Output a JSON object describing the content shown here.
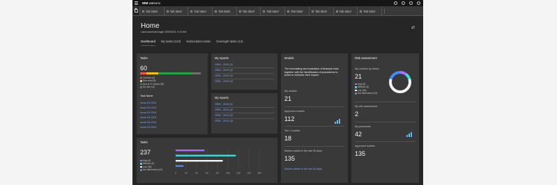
{
  "brand": {
    "prefix": "IBM",
    "name": "watsonx"
  },
  "tabs": [
    "Tab label",
    "Tab label",
    "Tab label",
    "Tab label",
    "Tab label",
    "Tab label",
    "Tab label",
    "Tab label",
    "Tab label",
    "Tab label"
  ],
  "page": {
    "title": "Home",
    "last_login": "Last successful login 3/30/2023, 9:12 AM"
  },
  "nav_tabs": [
    "Dashboard",
    "My tasks (123)",
    "Subscription tasks",
    "Oversight tasks (12)"
  ],
  "tasks_tile": {
    "title": "Tasks",
    "count": "60",
    "legend": [
      "Overdue (6)",
      "Due soon (6)",
      "Due in 2+ weeks (36)",
      "No due (12)"
    ],
    "colors": [
      "#fa4d56",
      "#f1c21b",
      "#24a148",
      "#6f6f6f"
    ],
    "fractions": [
      0.1,
      0.2,
      0.55,
      0.15
    ],
    "task_name_label": "Task Name",
    "issues": [
      "Issue-03-2301",
      "Issue-03-2301",
      "Issue-03-2301",
      "Issue-03-2301",
      "Issue-03-2301",
      "Issue-03-2301"
    ]
  },
  "reports_a": {
    "title": "My reports",
    "items": [
      "ORM - 2019 Q1",
      "ORM - 2019 Q2",
      "ORM - 2019 Q3",
      "ORM - 2019 Q4"
    ]
  },
  "reports_b": {
    "title": "My reports",
    "items": [
      "ORM - 2019 Q1",
      "ORM - 2019 Q2",
      "ORM - 2019 Q3",
      "ORM - 2019 Q4"
    ]
  },
  "models": {
    "title": "Models",
    "description": "The forecasting and evaluation of financial risks together with the identification of procedures to avoid or minimize their impact.",
    "my_models_label": "My models",
    "my_models": "21",
    "approved_label": "Approved models",
    "approved": "112",
    "tier1_label": "Tier 1 models",
    "tier1": "18",
    "added_label": "Models added in the last 30 days",
    "added": "135",
    "added_link": "Models added in the last 30 days"
  },
  "risk": {
    "title": "Risk assessment",
    "controls_label": "My controls by status",
    "controls": "21",
    "legend": [
      "High (6)",
      "Medium (6)",
      "Low (36)",
      "Not determined (12)"
    ],
    "colors": [
      "#a56eff",
      "#3ddbd9",
      "#f4f4f4",
      "#4589ff"
    ],
    "fractions": [
      0.1,
      0.1,
      0.6,
      0.2
    ],
    "assessment_label": "My risk assessment",
    "assessment": "2",
    "processes_label": "My processes",
    "processes": "42",
    "approved_label": "Approved models",
    "approved": "135"
  },
  "tasks_bar": {
    "title": "Tasks",
    "count": "237",
    "legend": [
      "High (6)",
      "Medium (6)",
      "Low (36)",
      "Not determined (12)"
    ],
    "colors": [
      "#a56eff",
      "#3ddbd9",
      "#f4f4f4",
      "#4589ff"
    ],
    "values": [
      55,
      115,
      90,
      15
    ],
    "ticks": [
      "0",
      "20",
      "40",
      "60",
      "80",
      "100",
      "120",
      "140",
      "160"
    ]
  }
}
